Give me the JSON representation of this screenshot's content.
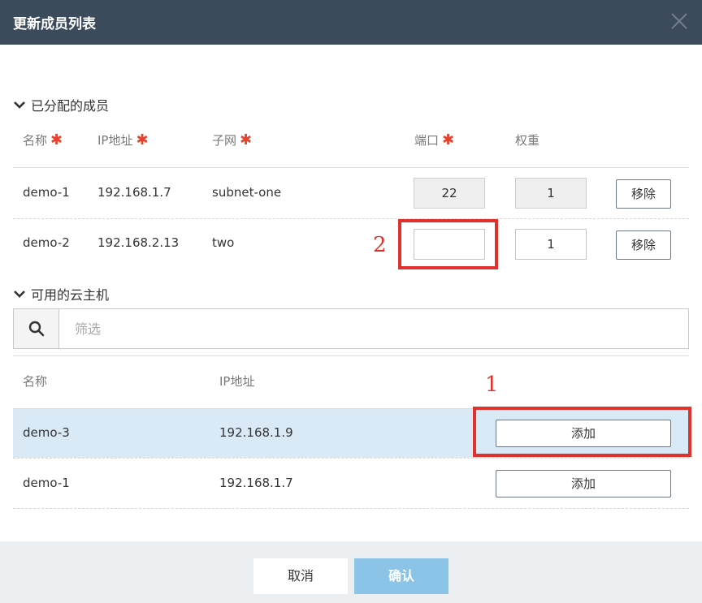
{
  "dialog": {
    "title": "更新成员列表"
  },
  "assigned": {
    "section_title": "已分配的成员",
    "columns": {
      "name": "名称",
      "ip": "IP地址",
      "subnet": "子网",
      "port": "端口",
      "weight": "权重"
    },
    "required_mark": "✱",
    "rows": [
      {
        "name": "demo-1",
        "ip": "192.168.1.7",
        "subnet": "subnet-one",
        "port": "22",
        "weight": "1",
        "remove_label": "移除"
      },
      {
        "name": "demo-2",
        "ip": "192.168.2.13",
        "subnet": "two",
        "port": "",
        "weight": "1",
        "remove_label": "移除"
      }
    ]
  },
  "available": {
    "section_title": "可用的云主机",
    "filter_placeholder": "筛选",
    "columns": {
      "name": "名称",
      "ip": "IP地址"
    },
    "rows": [
      {
        "name": "demo-3",
        "ip": "192.168.1.9",
        "add_label": "添加"
      },
      {
        "name": "demo-1",
        "ip": "192.168.1.7",
        "add_label": "添加"
      }
    ]
  },
  "annotations": {
    "one": "1",
    "two": "2"
  },
  "footer": {
    "cancel_label": "取消",
    "confirm_label": "确认"
  },
  "colors": {
    "header_bg": "#3c4b5c",
    "required": "#e8412c",
    "highlight_row": "#d9eaf6",
    "annotation": "#e0312d",
    "confirm_button": "#8cc4e8"
  },
  "icons": {
    "close": "close-icon",
    "chevron": "chevron-down-icon",
    "search": "search-icon"
  }
}
